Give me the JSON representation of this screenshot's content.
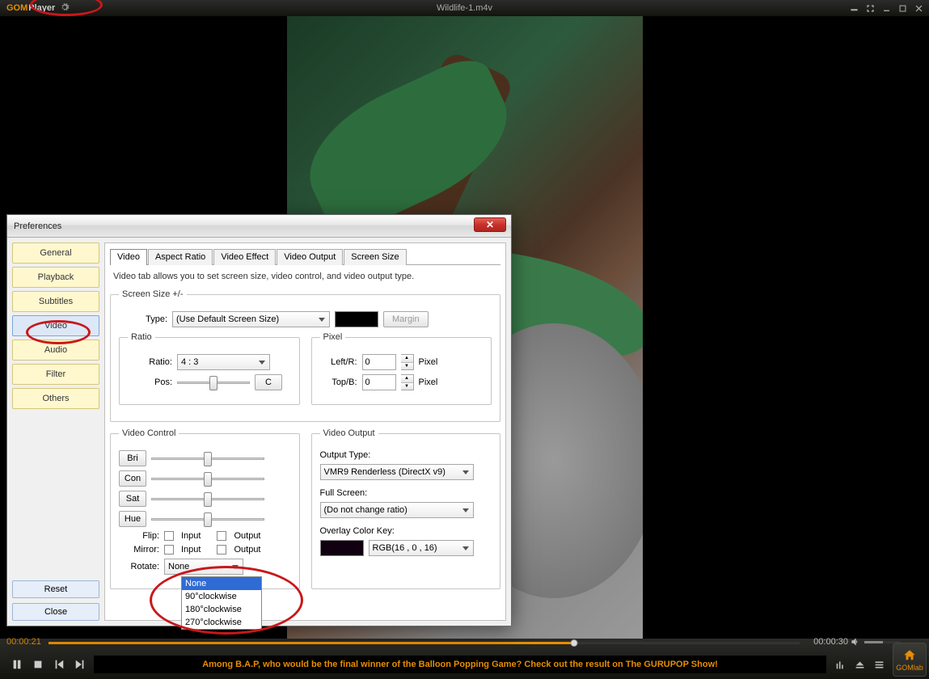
{
  "app": {
    "brand_a": "GOM",
    "brand_b": "Player",
    "file_title": "Wildlife-1.m4v"
  },
  "playback": {
    "current_time": "00:00:21",
    "total_time": "00:00:30"
  },
  "ticker": {
    "text": "Among B.A.P, who would be the final winner of the Balloon Popping Game? Check out the result on The GURUPOP Show!"
  },
  "home": {
    "label": "GOMlab"
  },
  "prefs": {
    "title": "Preferences",
    "categories": [
      "General",
      "Playback",
      "Subtitles",
      "Video",
      "Audio",
      "Filter",
      "Others"
    ],
    "selected_category": "Video",
    "reset": "Reset",
    "close": "Close",
    "tabs": [
      "Video",
      "Aspect Ratio",
      "Video Effect",
      "Video Output",
      "Screen Size"
    ],
    "active_tab": "Video",
    "desc": "Video tab allows you to set screen size, video control, and video output type.",
    "screen_group": "Screen Size +/-",
    "type_label": "Type:",
    "type_value": "(Use Default Screen Size)",
    "margin": "Margin",
    "ratio_group": "Ratio",
    "ratio_label": "Ratio:",
    "ratio_value": "4 : 3",
    "pos_label": "Pos:",
    "pos_btn": "C",
    "pixel_group": "Pixel",
    "left_r_label": "Left/R:",
    "top_b_label": "Top/B:",
    "pixel_unit": "Pixel",
    "pixel_value": "0",
    "vc_group": "Video Control",
    "bri": "Bri",
    "con": "Con",
    "sat": "Sat",
    "hue": "Hue",
    "flip_label": "Flip:",
    "mirror_label": "Mirror:",
    "rotate_label": "Rotate:",
    "input": "Input",
    "output": "Output",
    "rotate_value": "None",
    "rotate_options": [
      "None",
      "90°clockwise",
      "180°clockwise",
      "270°clockwise"
    ],
    "vo_group": "Video Output",
    "out_type_label": "Output Type:",
    "out_type_value": "VMR9 Renderless (DirectX v9)",
    "full_label": "Full Screen:",
    "full_value": "(Do not change ratio)",
    "overlay_label": "Overlay Color Key:",
    "overlay_rgb": "RGB(16 , 0 , 16)",
    "overlay_color": "#100010",
    "margin_color": "#000000"
  }
}
